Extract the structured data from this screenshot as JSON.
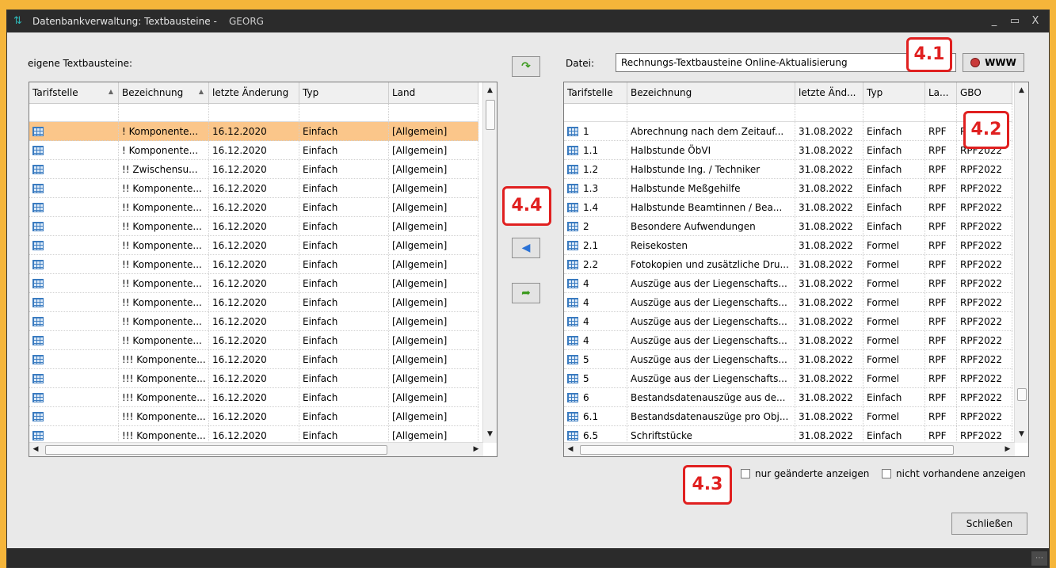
{
  "window": {
    "title": "Datenbankverwaltung: Textbausteine -",
    "subtitle": "GEORG",
    "minimize": "_",
    "maximize": "▭",
    "close": "X"
  },
  "left": {
    "label": "eigene Textbausteine:",
    "columns": [
      "Tarifstelle",
      "Bezeichnung",
      "letzte Änderung",
      "Typ",
      "Land"
    ],
    "rows": [
      [
        "",
        "! Komponente...",
        "16.12.2020",
        "Einfach",
        "[Allgemein]"
      ],
      [
        "",
        "! Komponente...",
        "16.12.2020",
        "Einfach",
        "[Allgemein]"
      ],
      [
        "",
        "!!  Zwischensu...",
        "16.12.2020",
        "Einfach",
        "[Allgemein]"
      ],
      [
        "",
        "!! Komponente...",
        "16.12.2020",
        "Einfach",
        "[Allgemein]"
      ],
      [
        "",
        "!! Komponente...",
        "16.12.2020",
        "Einfach",
        "[Allgemein]"
      ],
      [
        "",
        "!! Komponente...",
        "16.12.2020",
        "Einfach",
        "[Allgemein]"
      ],
      [
        "",
        "!! Komponente...",
        "16.12.2020",
        "Einfach",
        "[Allgemein]"
      ],
      [
        "",
        "!! Komponente...",
        "16.12.2020",
        "Einfach",
        "[Allgemein]"
      ],
      [
        "",
        "!! Komponente...",
        "16.12.2020",
        "Einfach",
        "[Allgemein]"
      ],
      [
        "",
        "!! Komponente...",
        "16.12.2020",
        "Einfach",
        "[Allgemein]"
      ],
      [
        "",
        "!! Komponente...",
        "16.12.2020",
        "Einfach",
        "[Allgemein]"
      ],
      [
        "",
        "!! Komponente...",
        "16.12.2020",
        "Einfach",
        "[Allgemein]"
      ],
      [
        "",
        "!!! Komponente...",
        "16.12.2020",
        "Einfach",
        "[Allgemein]"
      ],
      [
        "",
        "!!! Komponente...",
        "16.12.2020",
        "Einfach",
        "[Allgemein]"
      ],
      [
        "",
        "!!! Komponente...",
        "16.12.2020",
        "Einfach",
        "[Allgemein]"
      ],
      [
        "",
        "!!! Komponente...",
        "16.12.2020",
        "Einfach",
        "[Allgemein]"
      ],
      [
        "",
        "!!! Komponente...",
        "16.12.2020",
        "Einfach",
        "[Allgemein]"
      ]
    ]
  },
  "right": {
    "datei_label": "Datei:",
    "datei_value": "Rechnungs-Textbausteine Online-Aktualisierung",
    "www_label": "WWW",
    "columns": [
      "Tarifstelle",
      "Bezeichnung",
      "letzte Änd...",
      "Typ",
      "La...",
      "GBO"
    ],
    "rows": [
      [
        "1",
        "Abrechnung nach dem Zeitauf...",
        "31.08.2022",
        "Einfach",
        "RPF",
        "RPF2022"
      ],
      [
        "1.1",
        "Halbstunde ÖbVI",
        "31.08.2022",
        "Einfach",
        "RPF",
        "RPF2022"
      ],
      [
        "1.2",
        "Halbstunde Ing. / Techniker",
        "31.08.2022",
        "Einfach",
        "RPF",
        "RPF2022"
      ],
      [
        "1.3",
        "Halbstunde Meßgehilfe",
        "31.08.2022",
        "Einfach",
        "RPF",
        "RPF2022"
      ],
      [
        "1.4",
        "Halbstunde Beamtinnen / Bea...",
        "31.08.2022",
        "Einfach",
        "RPF",
        "RPF2022"
      ],
      [
        "2",
        "Besondere Aufwendungen",
        "31.08.2022",
        "Einfach",
        "RPF",
        "RPF2022"
      ],
      [
        "2.1",
        "Reisekosten",
        "31.08.2022",
        "Formel",
        "RPF",
        "RPF2022"
      ],
      [
        "2.2",
        "Fotokopien und zusätzliche Dru...",
        "31.08.2022",
        "Formel",
        "RPF",
        "RPF2022"
      ],
      [
        "4",
        "Auszüge aus der Liegenschafts...",
        "31.08.2022",
        "Formel",
        "RPF",
        "RPF2022"
      ],
      [
        "4",
        "Auszüge aus der Liegenschafts...",
        "31.08.2022",
        "Formel",
        "RPF",
        "RPF2022"
      ],
      [
        "4",
        "Auszüge aus der Liegenschafts...",
        "31.08.2022",
        "Formel",
        "RPF",
        "RPF2022"
      ],
      [
        "4",
        "Auszüge aus der Liegenschafts...",
        "31.08.2022",
        "Formel",
        "RPF",
        "RPF2022"
      ],
      [
        "5",
        "Auszüge aus der Liegenschafts...",
        "31.08.2022",
        "Formel",
        "RPF",
        "RPF2022"
      ],
      [
        "5",
        "Auszüge aus der Liegenschafts...",
        "31.08.2022",
        "Formel",
        "RPF",
        "RPF2022"
      ],
      [
        "6",
        "Bestandsdatenauszüge aus de...",
        "31.08.2022",
        "Einfach",
        "RPF",
        "RPF2022"
      ],
      [
        "6.1",
        "Bestandsdatenauszüge pro Obj...",
        "31.08.2022",
        "Formel",
        "RPF",
        "RPF2022"
      ],
      [
        "6.5",
        "Schriftstücke",
        "31.08.2022",
        "Einfach",
        "RPF",
        "RPF2022"
      ]
    ],
    "chk_changed": "nur geänderte anzeigen",
    "chk_missing": "nicht vorhandene anzeigen"
  },
  "buttons": {
    "close": "Schließen"
  },
  "badges": {
    "b41": "4.1",
    "b42": "4.2",
    "b43": "4.3",
    "b44": "4.4"
  },
  "colors": {
    "selected_row": "#fbc68a",
    "badge_red": "#e02020",
    "background": "#f5b53a"
  }
}
